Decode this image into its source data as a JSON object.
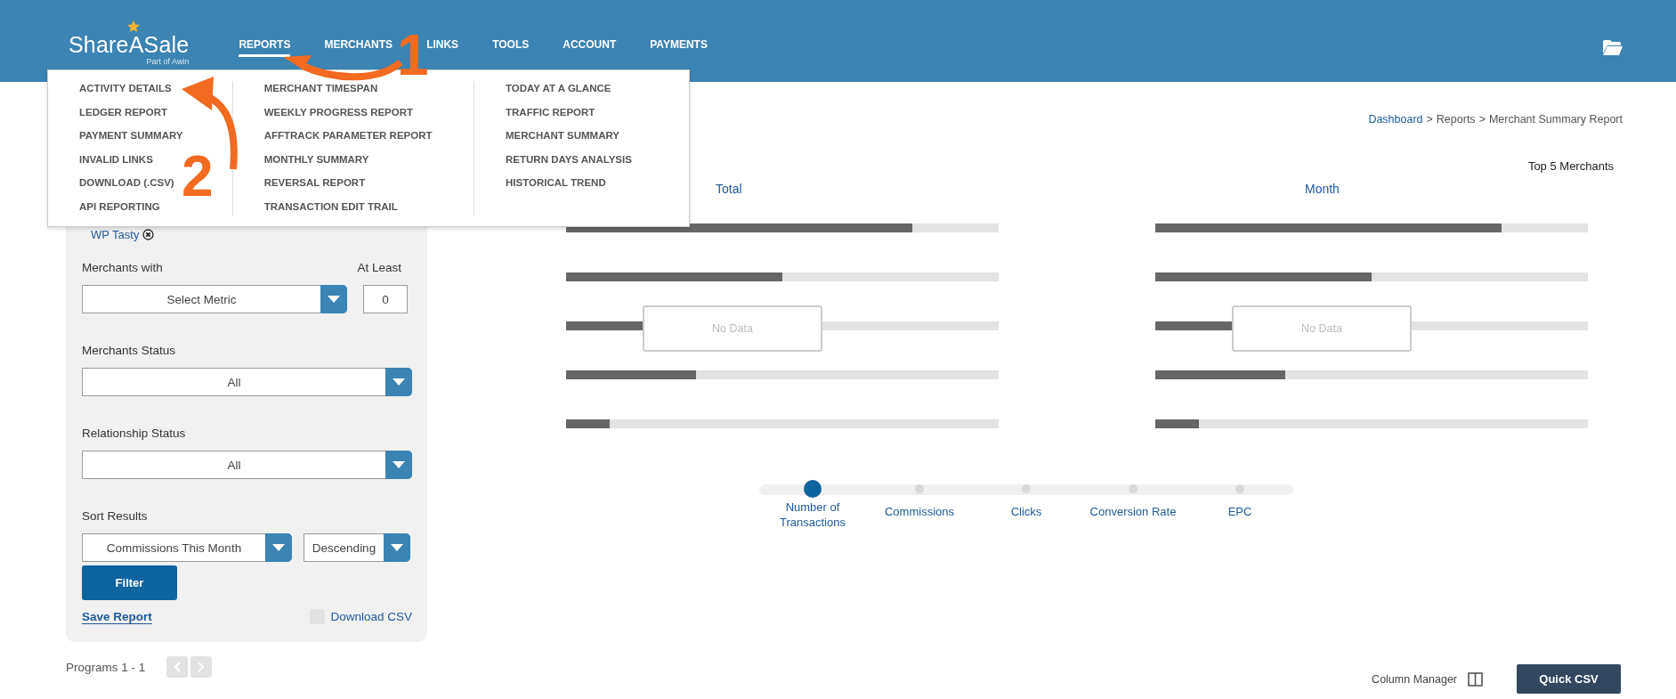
{
  "header": {
    "logo": {
      "name": "ShareASale",
      "tagline": "Part of Awin"
    },
    "nav": [
      {
        "label": "REPORTS",
        "selected": true
      },
      {
        "label": "MERCHANTS",
        "selected": false
      },
      {
        "label": "LINKS",
        "selected": false
      },
      {
        "label": "TOOLS",
        "selected": false
      },
      {
        "label": "ACCOUNT",
        "selected": false
      },
      {
        "label": "PAYMENTS",
        "selected": false
      }
    ]
  },
  "reports_menu": {
    "columns": [
      [
        "ACTIVITY DETAILS",
        "LEDGER REPORT",
        "PAYMENT SUMMARY",
        "INVALID LINKS",
        "DOWNLOAD (.CSV)",
        "API REPORTING"
      ],
      [
        "MERCHANT TIMESPAN",
        "WEEKLY PROGRESS REPORT",
        "AFFTRACK PARAMETER REPORT",
        "MONTHLY SUMMARY",
        "REVERSAL REPORT",
        "TRANSACTION EDIT TRAIL"
      ],
      [
        "TODAY AT A GLANCE",
        "TRAFFIC REPORT",
        "MERCHANT SUMMARY",
        "RETURN DAYS ANALYSIS",
        "HISTORICAL TREND"
      ]
    ]
  },
  "annotations": [
    {
      "label": "1"
    },
    {
      "label": "2"
    }
  ],
  "filters": {
    "tag": "WP Tasty",
    "merchants_with": {
      "label": "Merchants with",
      "value": "Select Metric"
    },
    "at_least": {
      "label": "At Least",
      "value": "0"
    },
    "merchants_status": {
      "label": "Merchants Status",
      "value": "All"
    },
    "relationship_status": {
      "label": "Relationship Status",
      "value": "All"
    },
    "sort": {
      "label": "Sort Results",
      "field": "Commissions This Month",
      "order": "Descending"
    },
    "filter_button": "Filter",
    "save_report": "Save Report",
    "download_csv": {
      "label": "Download CSV",
      "checked": false
    }
  },
  "pagination": {
    "label": "Programs 1 - 1"
  },
  "breadcrumb": {
    "items": [
      "Dashboard",
      "Reports",
      "Merchant Summary Report"
    ],
    "separator": ">"
  },
  "top_merchants": {
    "title": "Top 5 Merchants",
    "panels": [
      {
        "title": "Total",
        "empty_message": "No Data",
        "bars": [
          {
            "level": 0.8
          },
          {
            "level": 0.5
          },
          {
            "level": 0.4
          },
          {
            "level": 0.3
          },
          {
            "level": 0.1
          }
        ]
      },
      {
        "title": "Month",
        "empty_message": "No Data",
        "bars": [
          {
            "level": 0.8
          },
          {
            "level": 0.5
          },
          {
            "level": 0.4
          },
          {
            "level": 0.3
          },
          {
            "level": 0.1
          }
        ]
      }
    ],
    "metrics": [
      {
        "label": "Number of Transactions",
        "selected": true
      },
      {
        "label": "Commissions",
        "selected": false
      },
      {
        "label": "Clicks",
        "selected": false
      },
      {
        "label": "Conversion Rate",
        "selected": false
      },
      {
        "label": "EPC",
        "selected": false
      }
    ]
  },
  "footer": {
    "column_manager": "Column Manager",
    "quick_csv": "Quick CSV"
  }
}
